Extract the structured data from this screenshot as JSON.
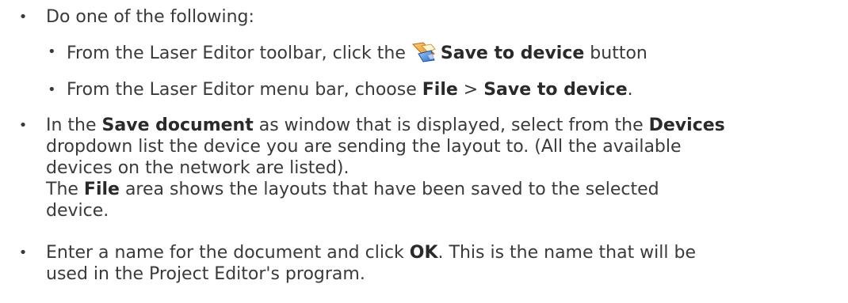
{
  "step1": {
    "bullet": "•",
    "text": "Do one of the following:"
  },
  "sub1": {
    "bullet": "•",
    "prefix": "From the Laser Editor toolbar, click the",
    "icon": "save-to-device-icon",
    "bold": "Save to device",
    "suffix": " button"
  },
  "sub2": {
    "bullet": "•",
    "prefix": "From the Laser Editor menu bar, choose ",
    "bold1": "File",
    "sep": " > ",
    "bold2": "Save to device",
    "suffix": "."
  },
  "step2": {
    "bullet": "•",
    "l1_a": "In the ",
    "l1_b": "Save document",
    "l1_c": " as window that is displayed, select from the ",
    "l1_d": "Devices",
    "l2": "dropdown list the device you are sending the layout to. (All the available",
    "l3": "devices on the network are listed).",
    "l4_a": "The ",
    "l4_b": "File",
    "l4_c": " area shows the layouts that have been saved to the selected",
    "l5": "device."
  },
  "step3": {
    "bullet": "•",
    "l1_a": "Enter a name for the document and click ",
    "l1_b": "OK",
    "l1_c": ". This is the name that will be",
    "l2": "used in the Project Editor's program."
  },
  "colors": {
    "text": "#3a3a3a",
    "icon_orange": "#f29a1a",
    "icon_blue": "#3a7fd0"
  }
}
